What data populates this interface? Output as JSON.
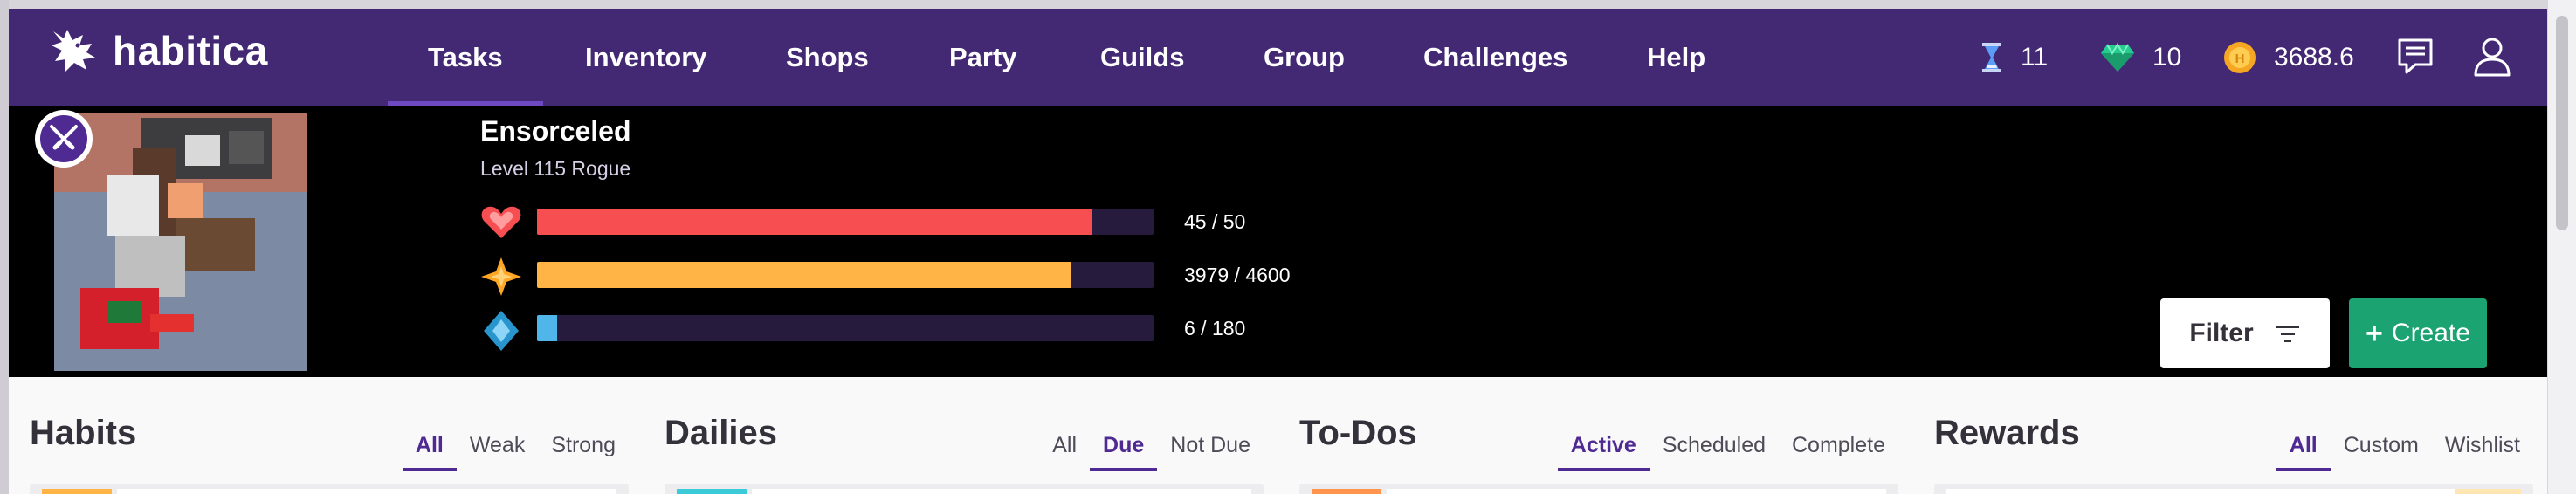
{
  "brand": {
    "name": "habitica"
  },
  "nav": {
    "items": [
      {
        "label": "Tasks",
        "active": true
      },
      {
        "label": "Inventory",
        "active": false
      },
      {
        "label": "Shops",
        "active": false
      },
      {
        "label": "Party",
        "active": false
      },
      {
        "label": "Guilds",
        "active": false
      },
      {
        "label": "Group",
        "active": false
      },
      {
        "label": "Challenges",
        "active": false
      },
      {
        "label": "Help",
        "active": false
      }
    ],
    "currency": {
      "hourglasses": "11",
      "gems": "10",
      "gold": "3688.6"
    },
    "icons": [
      "hourglass-icon",
      "gem-icon",
      "gold-coin-icon",
      "messages-icon",
      "user-icon"
    ]
  },
  "profile": {
    "name": "Ensorceled",
    "level_text": "Level 115 Rogue",
    "class_icon": "rogue-class-icon",
    "bars": {
      "health": {
        "text": "45 / 50",
        "fraction": 0.9,
        "color": "#f74e52"
      },
      "experience": {
        "text": "3979 / 4600",
        "fraction": 0.865,
        "color": "#ffb445"
      },
      "mana": {
        "text": "6 / 180",
        "fraction": 0.033,
        "color": "#50b5e9"
      }
    }
  },
  "actions": {
    "filter_label": "Filter",
    "create_label": "Create"
  },
  "columns": {
    "habits": {
      "title": "Habits",
      "filters": [
        "All",
        "Weak",
        "Strong"
      ],
      "active": "All",
      "tag_color": "#ffb445"
    },
    "dailies": {
      "title": "Dailies",
      "filters": [
        "All",
        "Due",
        "Not Due"
      ],
      "active": "Due",
      "tag_color": "#3bcad7"
    },
    "todos": {
      "title": "To-Dos",
      "filters": [
        "Active",
        "Scheduled",
        "Complete"
      ],
      "active": "Active",
      "tag_color": "#ff944c"
    },
    "rewards": {
      "title": "Rewards",
      "filters": [
        "All",
        "Custom",
        "Wishlist"
      ],
      "active": "All",
      "tag_color": "#ffe6b3"
    }
  },
  "colors": {
    "nav_bg": "#432874",
    "accent": "#4f2a93",
    "create": "#1ca372"
  }
}
